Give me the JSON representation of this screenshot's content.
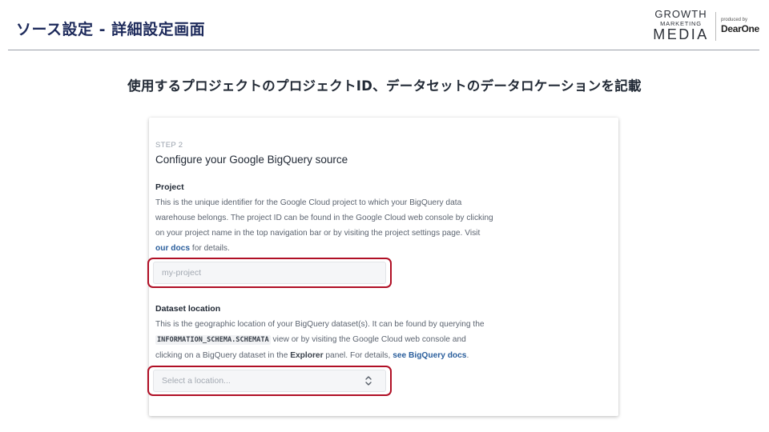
{
  "header": {
    "title": "ソース設定 - 詳細設定画面",
    "logo_growth_line1": "GROWTH",
    "logo_growth_line2": "MARKETING",
    "logo_growth_line3": "MEDIA",
    "logo_produced_by": "produced by",
    "logo_dearone": "DearOne"
  },
  "subtitle": "使用するプロジェクトのプロジェクトID、データセットのデータロケーションを記載",
  "card": {
    "step": "STEP 2",
    "title": "Configure your Google BigQuery source",
    "project": {
      "label": "Project",
      "desc_line1": "This is the unique identifier for the Google Cloud project to which your BigQuery data",
      "desc_line2": "warehouse belongs. The project ID can be found in the Google Cloud web console by clicking",
      "desc_line3": "on your project name in the top navigation bar or by visiting the project settings page. Visit",
      "docs_link": "our docs",
      "desc_tail": " for details.",
      "placeholder": "my-project"
    },
    "dataset_location": {
      "label": "Dataset location",
      "desc_line1": "This is the geographic location of your BigQuery dataset(s). It can be found by querying the",
      "code": "INFORMATION_SCHEMA.SCHEMATA",
      "desc_line2_rest": " view or by visiting the Google Cloud web console and",
      "desc_line3_a": "clicking on a BigQuery dataset in the ",
      "explorer": "Explorer",
      "desc_line3_b": " panel. For details, ",
      "bq_docs_link": "see BigQuery docs",
      "desc_line3_end": ".",
      "placeholder": "Select a location...",
      "chevron_icon": "chevron-up-down-icon"
    }
  },
  "colors": {
    "highlight": "#b00f25",
    "link": "#2a5e9c",
    "title": "#1d2a5b"
  }
}
